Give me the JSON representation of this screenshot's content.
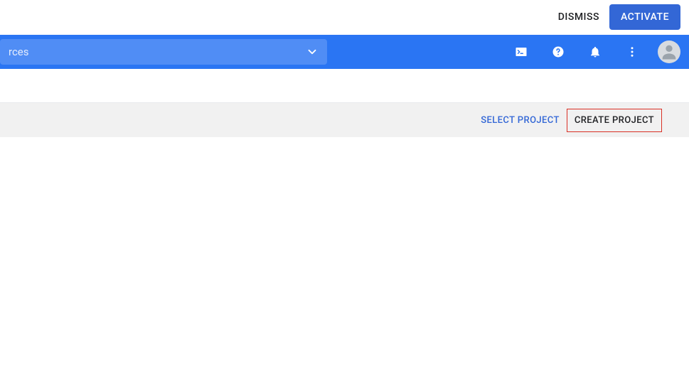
{
  "banner": {
    "dismiss_label": "DISMISS",
    "activate_label": "ACTIVATE"
  },
  "header": {
    "search_text": "rces"
  },
  "action_bar": {
    "select_project_label": "SELECT PROJECT",
    "create_project_label": "CREATE PROJECT"
  }
}
